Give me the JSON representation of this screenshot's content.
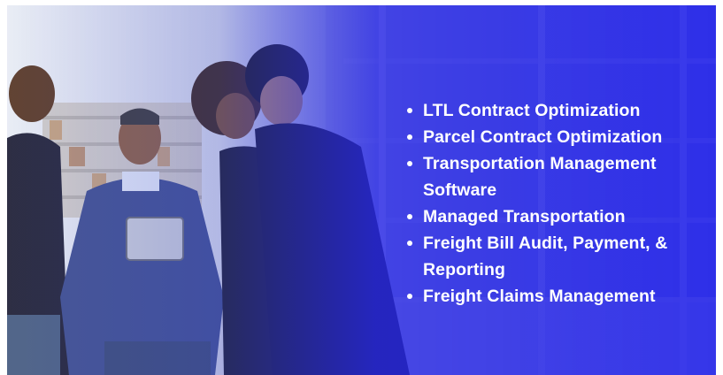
{
  "services": [
    "LTL Contract Optimization",
    "Parcel Contract Optimization",
    "Transportation Management Software",
    "Managed Transportation",
    "Freight Bill Audit, Payment, & Reporting",
    "Freight Claims Management"
  ],
  "colors": {
    "overlay": "#2a2ae8",
    "text": "#ffffff"
  }
}
